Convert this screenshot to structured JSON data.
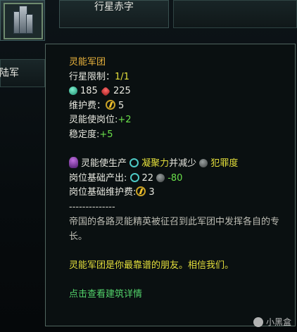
{
  "background": {
    "planet_tab_label": "行星赤字",
    "left_tab_label": "陆军"
  },
  "tooltip": {
    "title": "灵能军团",
    "planet_limit_label": "行星限制：",
    "planet_limit_value": "1/1",
    "cost_energy_amount": "185",
    "cost_red_amount": "225",
    "upkeep_label": "维护费：",
    "upkeep_value": "5",
    "jobs_label": "灵能使岗位:",
    "jobs_value": "+2",
    "stability_label": "稳定度:",
    "stability_value": "+5",
    "produce_prefix": "灵能使生产",
    "produce_resource": "凝聚力",
    "produce_middle": "并减少",
    "produce_reduce": "犯罪度",
    "base_output_label": "岗位基础产出:",
    "base_output_unity": "22",
    "base_output_crime": "-80",
    "base_upkeep_label": "岗位基础维护费:",
    "base_upkeep_value": "3",
    "divider": "--------------",
    "description": "帝国的各路灵能精英被征召到此军团中发挥各自的专长。",
    "flavor": "灵能军团是你最靠谱的朋友。相信我们。",
    "details_link": "点击查看建筑详情"
  },
  "watermark": "小黑盒",
  "colors": {
    "title": "#e8b23c",
    "yellow": "#e4df3b",
    "green": "#6ae04a",
    "link": "#53d36b"
  },
  "icons": [
    "energy-credits-icon",
    "minerals-icon",
    "alloys-icon",
    "unity-icon",
    "crime-icon",
    "psionic-pop-icon"
  ]
}
